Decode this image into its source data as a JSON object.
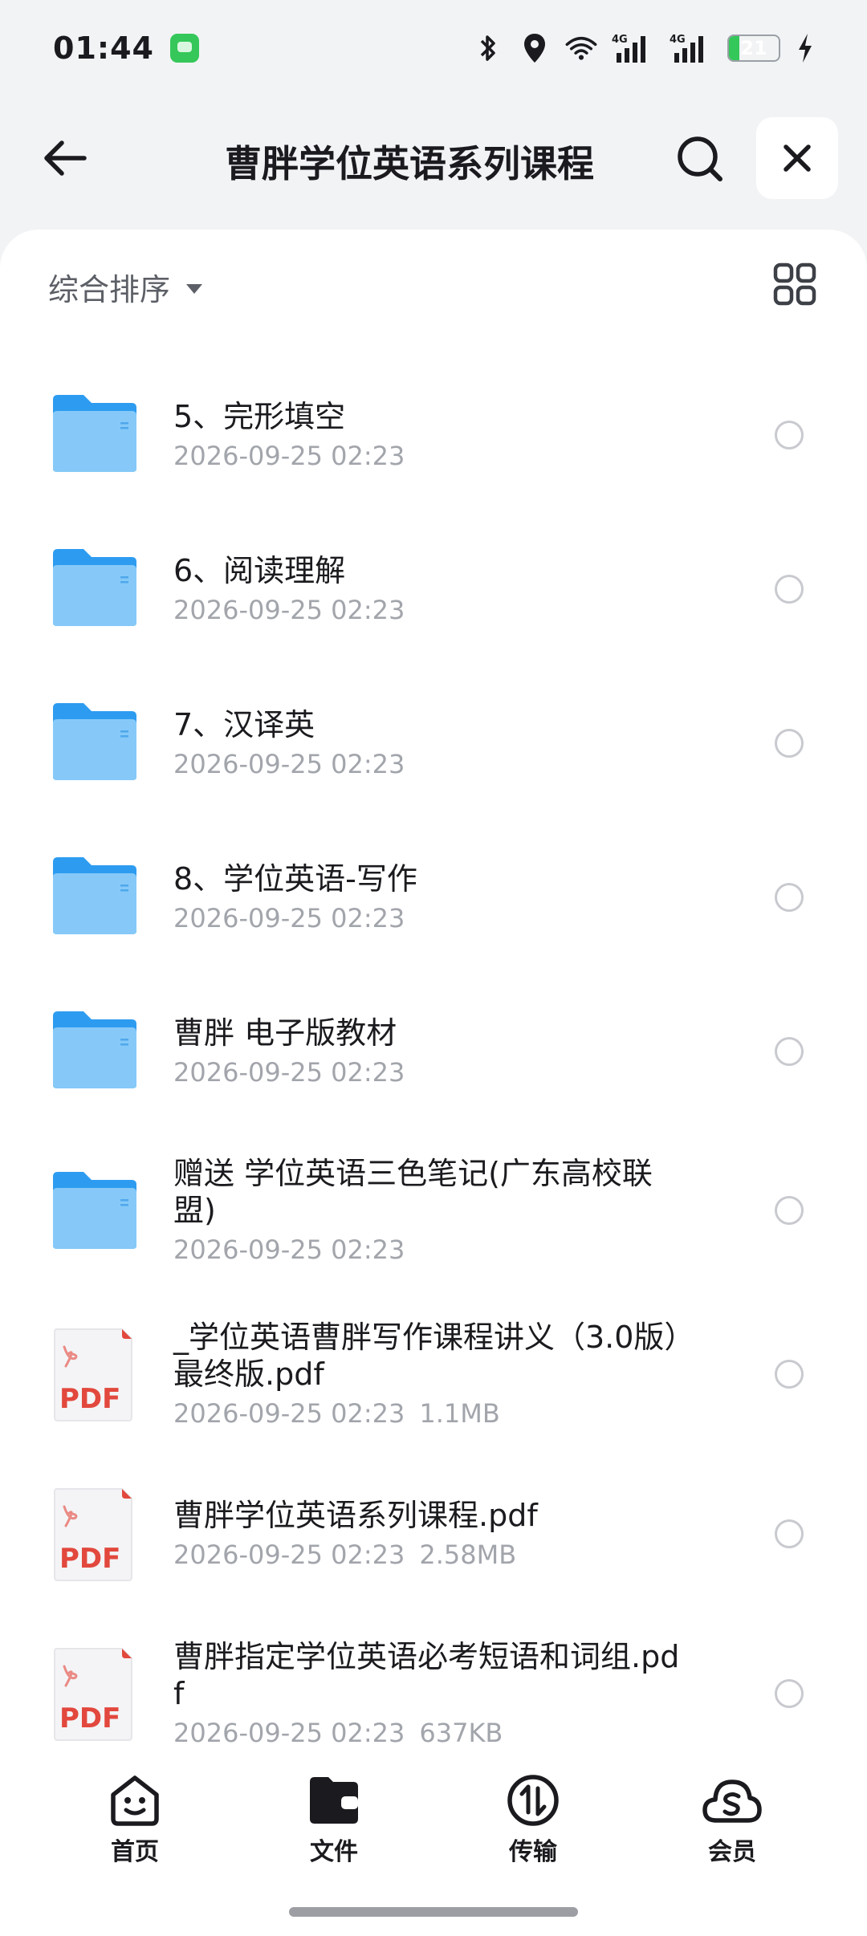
{
  "status_bar": {
    "time": "01:44",
    "network_1": "4G",
    "network_2": "4G",
    "battery_percent": 21,
    "battery_text": "21",
    "icons": [
      "message-app-icon",
      "bluetooth-icon",
      "location-icon",
      "wifi-icon",
      "signal-icon",
      "signal-icon",
      "battery-icon",
      "charging-icon"
    ]
  },
  "header": {
    "title": "曹胖学位英语系列课程",
    "back_icon": "back-arrow-icon",
    "search_icon": "search-icon",
    "close_icon": "close-icon"
  },
  "toolbar": {
    "sort_label": "综合排序",
    "view_toggle_icon": "grid-view-icon"
  },
  "files": [
    {
      "type": "folder",
      "name": "5、完形填空",
      "date": "2026-09-25 02:23",
      "size": ""
    },
    {
      "type": "folder",
      "name": "6、阅读理解",
      "date": "2026-09-25 02:23",
      "size": ""
    },
    {
      "type": "folder",
      "name": "7、汉译英",
      "date": "2026-09-25 02:23",
      "size": ""
    },
    {
      "type": "folder",
      "name": "8、学位英语-写作",
      "date": "2026-09-25 02:23",
      "size": ""
    },
    {
      "type": "folder",
      "name": "曹胖 电子版教材",
      "date": "2026-09-25 02:23",
      "size": ""
    },
    {
      "type": "folder",
      "name": "赠送 学位英语三色笔记(广东高校联盟)",
      "date": "2026-09-25 02:23",
      "size": ""
    },
    {
      "type": "pdf",
      "name": "_学位英语曹胖写作课程讲义（3.0版）最终版.pdf",
      "date": "2026-09-25 02:23",
      "size": "1.1MB"
    },
    {
      "type": "pdf",
      "name": "曹胖学位英语系列课程.pdf",
      "date": "2026-09-25 02:23",
      "size": "2.58MB"
    },
    {
      "type": "pdf",
      "name": "曹胖指定学位英语必考短语和词组.pdf",
      "date": "2026-09-25 02:23",
      "size": "637KB"
    }
  ],
  "pdf_badge": "PDF",
  "colors": {
    "folder": "#4fb0f5",
    "pdf_red": "#e2483d",
    "accent_black": "#1b1b1f"
  },
  "bottom_nav": [
    {
      "label": "首页",
      "icon": "home-face-icon",
      "active": false
    },
    {
      "label": "文件",
      "icon": "folder-wallet-icon",
      "active": true
    },
    {
      "label": "传输",
      "icon": "transfer-icon",
      "active": false
    },
    {
      "label": "会员",
      "icon": "vip-cloud-icon",
      "active": false
    }
  ]
}
